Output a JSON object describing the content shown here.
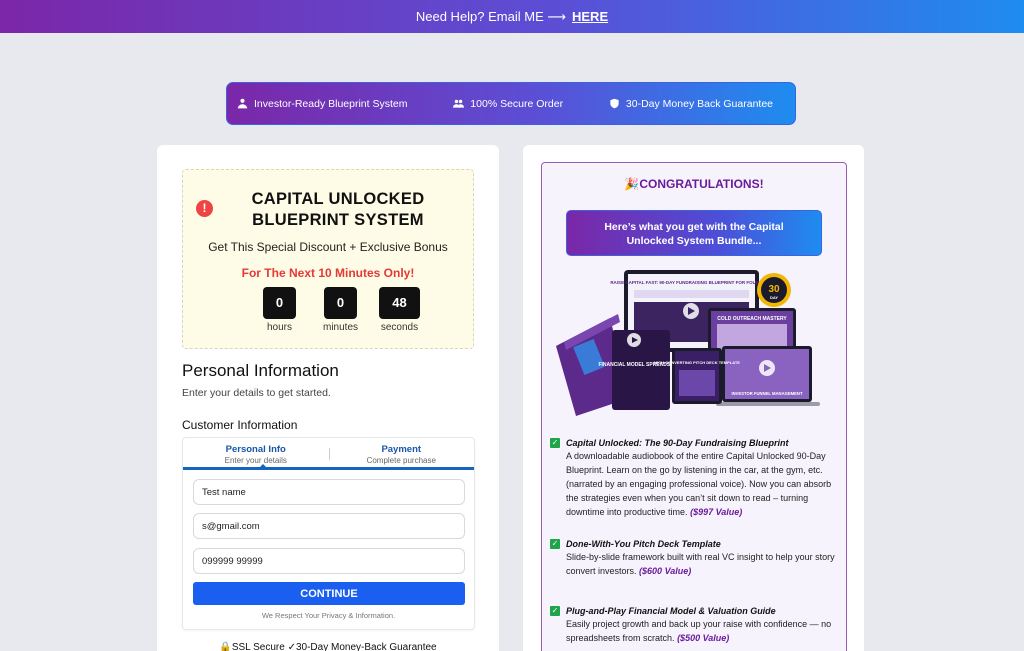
{
  "topbar": {
    "text": "Need Help? Email ME ⟶",
    "link": "HERE"
  },
  "trust": [
    {
      "label": "Investor-Ready Blueprint System",
      "icon": "user-hand-icon"
    },
    {
      "label": "100% Secure Order",
      "icon": "users-icon"
    },
    {
      "label": "30-Day Money Back Guarantee",
      "icon": "shield-icon"
    }
  ],
  "offer": {
    "title": "CAPITAL UNLOCKED BLUEPRINT SYSTEM",
    "subtitle": "Get This Special Discount + Exclusive Bonus",
    "timer_title": "For The Next 10 Minutes Only!",
    "countdown": [
      {
        "value": "0",
        "label": "hours"
      },
      {
        "value": "0",
        "label": "minutes"
      },
      {
        "value": "48",
        "label": "seconds"
      }
    ],
    "alert_glyph": "!"
  },
  "personal": {
    "title": "Personal Information",
    "subtitle": "Enter your details to get started."
  },
  "customer": {
    "title": "Customer Information"
  },
  "steps": [
    {
      "title": "Personal Info",
      "desc": "Enter your details"
    },
    {
      "title": "Payment",
      "desc": "Complete purchase"
    }
  ],
  "form": {
    "name": "Test name",
    "email": "s@gmail.com",
    "phone": "099999 99999",
    "continue": "CONTINUE",
    "privacy": "We Respect Your Privacy & Information."
  },
  "footer": {
    "secure": "🔒SSL Secure ✓30-Day Money-Back Guarantee"
  },
  "right": {
    "congrats": "🎉CONGRATULATIONS!",
    "bundle_line1": "Here’s what you get with the Capital",
    "bundle_line2": "Unlocked System Bundle...",
    "mockup": {
      "laptop_title": "RAISE CAPITAL FAST: 90-DAY FUNDRAISING BLUEPRINT FOR FOUNDERS",
      "cold": "COLD OUTREACH MASTERY",
      "funnel": "INVESTOR FUNNEL MANAGEMENT",
      "financial": "FINANCIAL MODEL SPREADSHEET",
      "pitch": "HIGH-CONVERTING PITCH DECK TEMPLATE",
      "badge_num": "30",
      "badge_text": "DAY"
    },
    "benefits": [
      {
        "title": "Capital Unlocked: The 90-Day Fundraising Blueprint",
        "desc": "A downloadable audiobook of the entire Capital Unlocked 90-Day Blueprint. Learn on the go by listening in the car, at the gym, etc. (narrated by an engaging professional voice). Now you can absorb the strategies even when you can’t sit down to read – turning downtime into productive time.",
        "value": "($997 Value)"
      },
      {
        "title": "Done-With-You Pitch Deck Template",
        "desc": "Slide-by-slide framework built with real VC insight to help your story convert investors.",
        "value": "($600 Value)"
      },
      {
        "title": "Plug-and-Play Financial Model & Valuation Guide",
        "desc": "Easily project growth and back up your raise with confidence — no spreadsheets from scratch.",
        "value": "($500 Value)"
      }
    ]
  }
}
